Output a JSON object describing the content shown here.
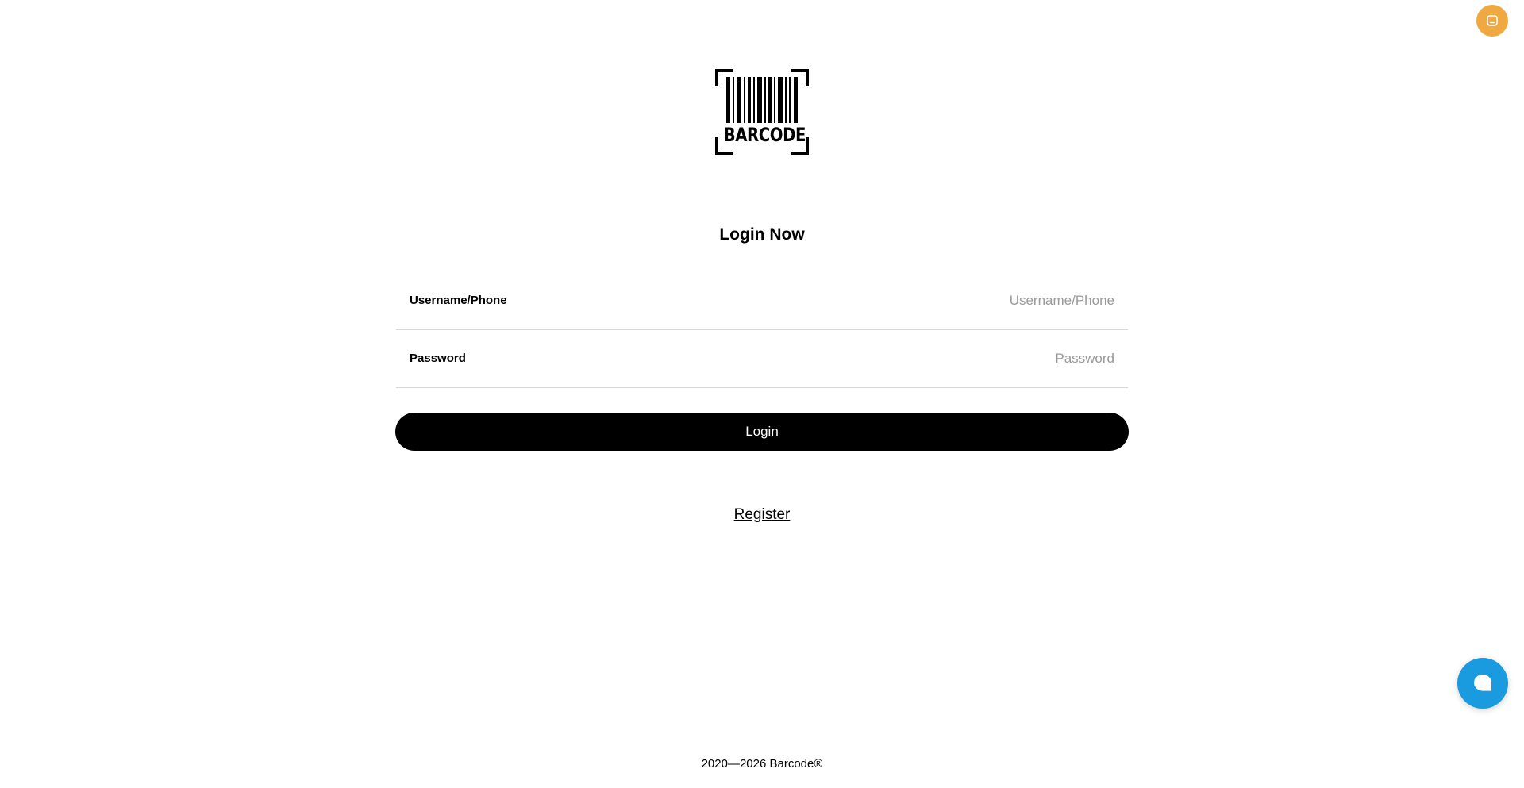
{
  "header": {
    "badge_icon": "message-square-icon",
    "badge_color": "#f0a940"
  },
  "logo": {
    "icon": "barcode-logo-icon",
    "word": "BARCODE"
  },
  "login": {
    "title": "Login Now",
    "username": {
      "label": "Username/Phone",
      "placeholder": "Username/Phone",
      "value": ""
    },
    "password": {
      "label": "Password",
      "placeholder": "Password",
      "value": ""
    },
    "submit_label": "Login",
    "register_label": "Register"
  },
  "chat": {
    "icon": "chat-bubble-icon",
    "color": "#1a9be0"
  },
  "footer": {
    "copyright": "2020—2026 Barcode®"
  }
}
